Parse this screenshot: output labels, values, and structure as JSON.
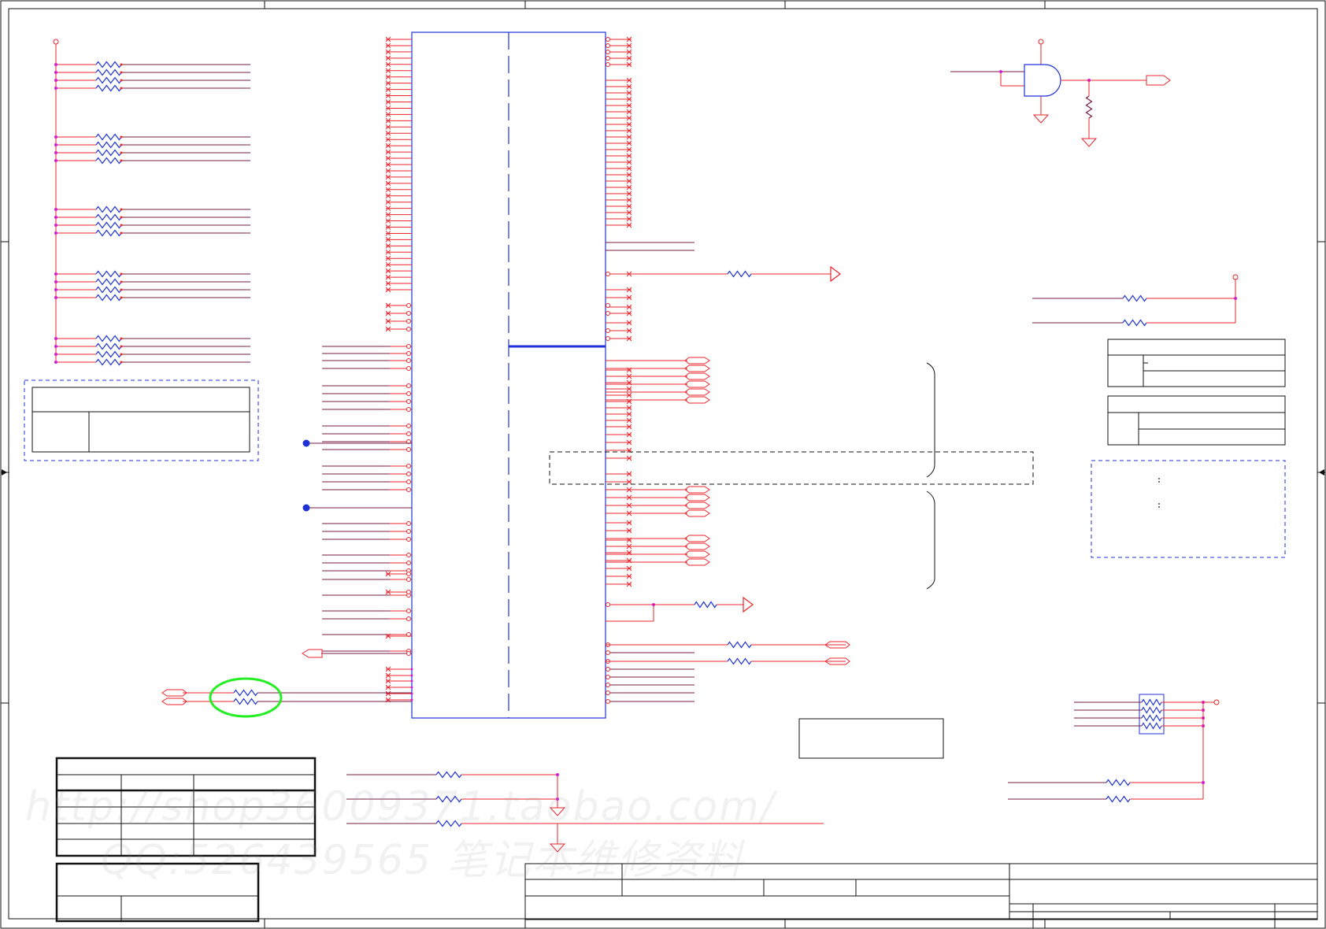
{
  "watermark": {
    "line1": "http://shop36009371.taobao.com/",
    "line2": "QQ:526439565 笔记本维修资料"
  }
}
